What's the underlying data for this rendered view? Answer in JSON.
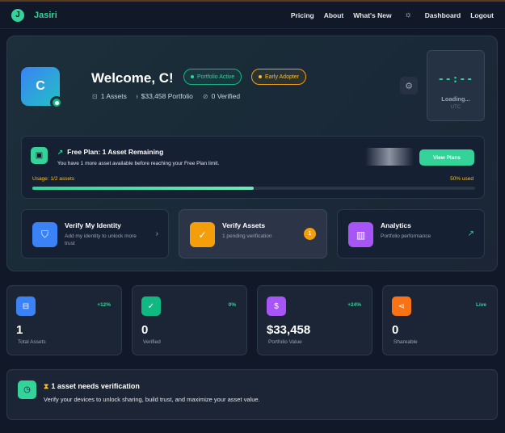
{
  "app": {
    "logo_letter": "J",
    "brand": "Jasiri"
  },
  "nav": {
    "items": [
      "Pricing",
      "About",
      "What's New"
    ],
    "theme_icon": "sun-icon",
    "dashboard": "Dashboard",
    "logout": "Logout"
  },
  "hero": {
    "avatar_letter": "C",
    "welcome": "Welcome, C!",
    "badges": {
      "portfolio": "Portfolio Active",
      "early": "Early Adopter"
    },
    "stats": {
      "assets": "1 Assets",
      "portfolio": "$33,458 Portfolio",
      "verified": "0 Verified"
    },
    "clock": {
      "time": "--:--",
      "status": "Loading...",
      "tz": "UTC"
    }
  },
  "plan": {
    "title": "Free Plan: 1 Asset Remaining",
    "subtitle": "You have 1 more asset available before reaching your Free Plan limit.",
    "button": "View Plans",
    "usage_label": "Usage: 1/2 assets",
    "percent_label": "50% used",
    "usage_fraction": 0.5
  },
  "quick_actions": [
    {
      "title": "Verify My Identity",
      "subtitle": "Add my identity to unlock more trust",
      "color": "#3b82f6",
      "icon": "shield-icon"
    },
    {
      "title": "Verify Assets",
      "subtitle": "1 pending verification",
      "count": "1",
      "color": "#f59e0b",
      "icon": "check-circle-icon"
    },
    {
      "title": "Analytics",
      "subtitle": "Portfolio performance",
      "color": "#a855f7",
      "icon": "bar-chart-icon"
    }
  ],
  "stats": [
    {
      "value": "1",
      "label": "Total Assets",
      "change": "+12%",
      "color": "#3b82f6",
      "icon": "box-icon"
    },
    {
      "value": "0",
      "label": "Verified",
      "change": "0%",
      "color": "#10b981",
      "icon": "check-icon"
    },
    {
      "value": "$33,458",
      "label": "Portfolio Value",
      "change": "+24%",
      "color": "#a855f7",
      "icon": "dollar-icon"
    },
    {
      "value": "0",
      "label": "Shareable",
      "change": "Live",
      "color": "#f97316",
      "icon": "share-icon"
    }
  ],
  "alert": {
    "title": "1 asset needs verification",
    "subtitle": "Verify your devices to unlock sharing, build trust, and maximize your asset value."
  }
}
